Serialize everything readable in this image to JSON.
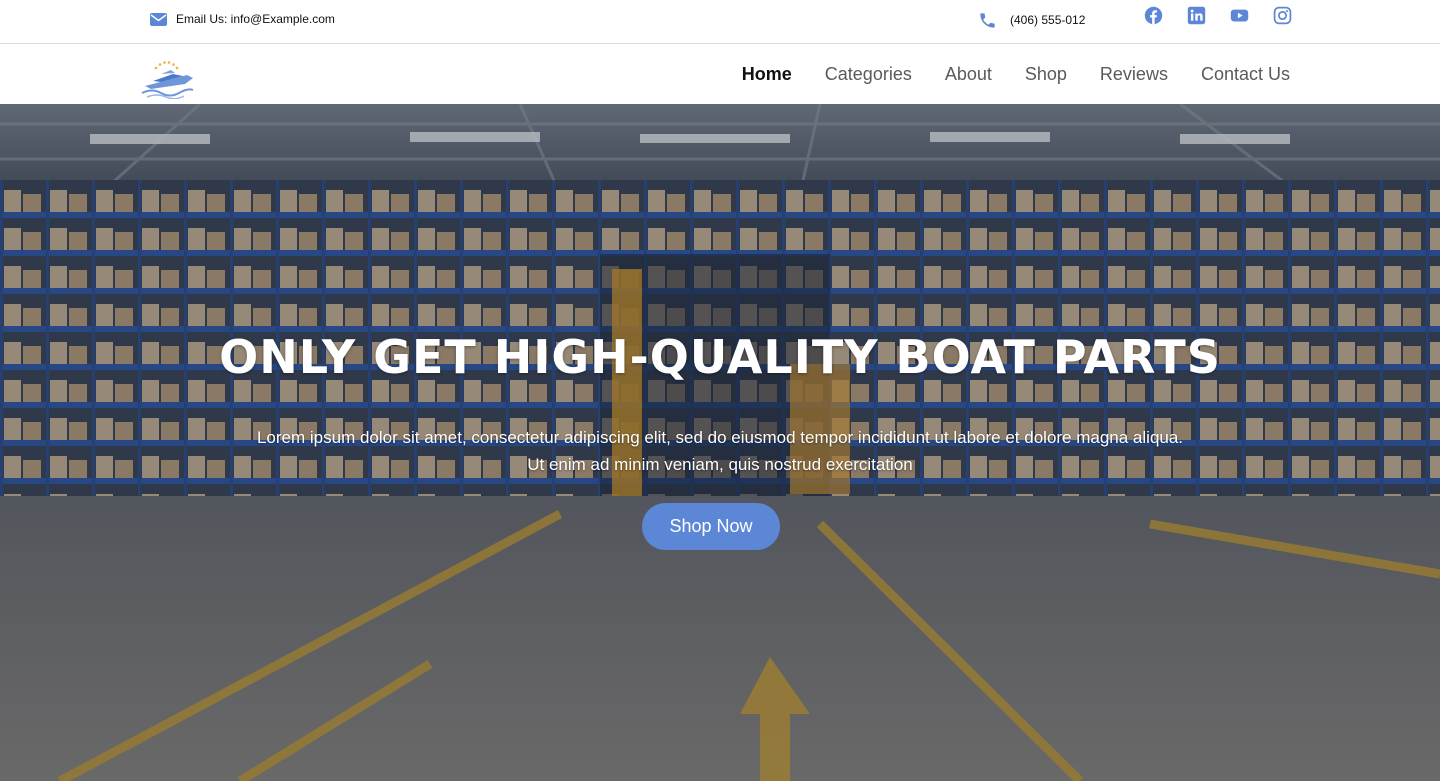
{
  "topbar": {
    "email_text": "Email Us: info@Example.com",
    "phone_text": "(406) 555-012",
    "icon_color": "#5b87d6",
    "social_icons": [
      "facebook-icon",
      "linkedin-icon",
      "youtube-icon",
      "instagram-icon"
    ]
  },
  "nav": {
    "logo_icon": "boat-logo",
    "items": [
      {
        "label": "Home",
        "active": true
      },
      {
        "label": "Categories",
        "active": false
      },
      {
        "label": "About",
        "active": false
      },
      {
        "label": "Shop",
        "active": false
      },
      {
        "label": "Reviews",
        "active": false
      },
      {
        "label": "Contact Us",
        "active": false
      }
    ]
  },
  "hero": {
    "title": "ONLY GET HIGH-QUALITY BOAT PARTS",
    "subtitle": "Lorem ipsum dolor sit amet, consectetur adipiscing elit, sed do eiusmod tempor incididunt ut labore et dolore magna aliqua. Ut enim ad minim veniam, quis nostrud exercitation",
    "cta_label": "Shop Now",
    "cta_color": "#5b87d6",
    "background": "warehouse-shelves-image"
  }
}
